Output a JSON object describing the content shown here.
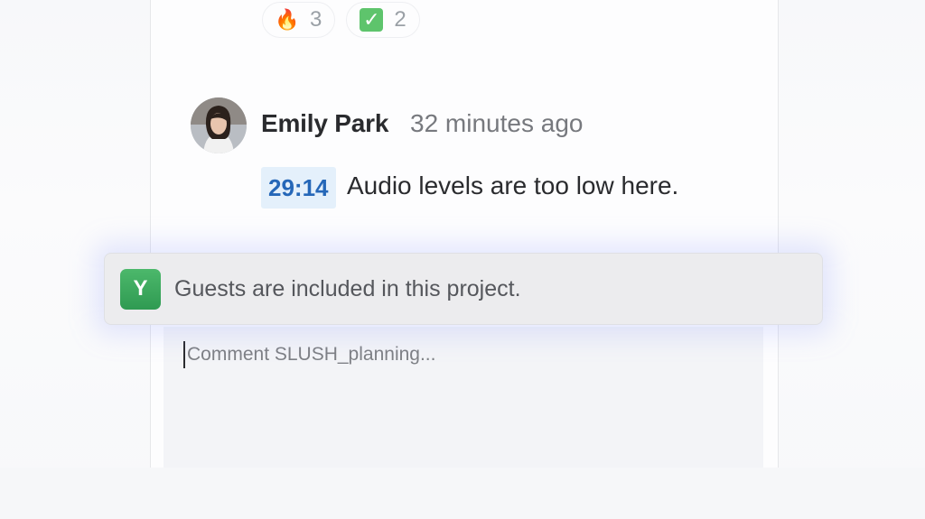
{
  "reactions": [
    {
      "icon": "fire-icon",
      "glyph": "🔥",
      "count": "3"
    },
    {
      "icon": "check-mark-icon",
      "glyph": "✓",
      "count": "2"
    }
  ],
  "comment": {
    "author": "Emily Park",
    "time_ago": "32 minutes ago",
    "timestamp": "29:14",
    "text": "Audio levels are too low here."
  },
  "notification": {
    "badge_letter": "Y",
    "text": "Guests are included in this project.",
    "badge_color": "#3aa85c"
  },
  "composer": {
    "placeholder": "Comment SLUSH_planning..."
  },
  "colors": {
    "timestamp_bg": "#e4f0fb",
    "timestamp_text": "#2567b8",
    "glow": "#7890ff"
  }
}
